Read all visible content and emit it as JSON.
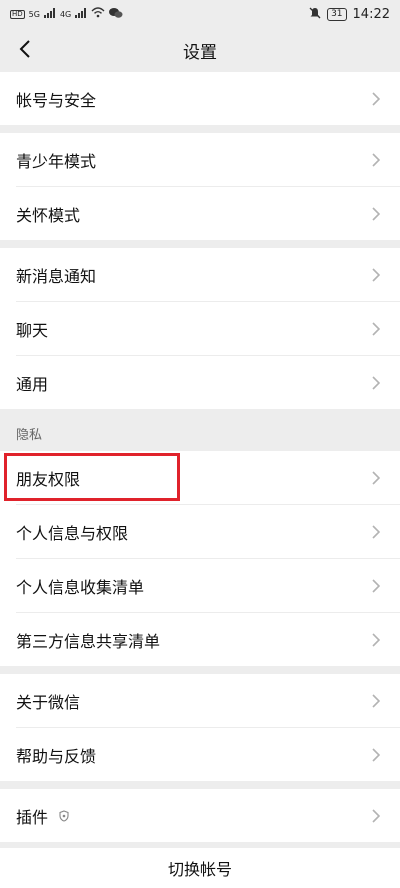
{
  "status_bar": {
    "hd1": "HD",
    "hd2": "HD",
    "net1": "5G",
    "net2": "4G",
    "battery": "31",
    "time": "14:22",
    "wechat_icon": "wechat-icon",
    "wifi_icon": "wifi-icon",
    "mute_icon": "mute-icon"
  },
  "nav": {
    "title": "设置",
    "back_icon": "chevron-left-icon"
  },
  "groups": {
    "account": {
      "items": [
        "帐号与安全"
      ]
    },
    "mode": {
      "items": [
        "青少年模式",
        "关怀模式"
      ]
    },
    "general": {
      "items": [
        "新消息通知",
        "聊天",
        "通用"
      ]
    },
    "privacy": {
      "label": "隐私",
      "items": [
        "朋友权限",
        "个人信息与权限",
        "个人信息收集清单",
        "第三方信息共享清单"
      ]
    },
    "about": {
      "items": [
        "关于微信",
        "帮助与反馈"
      ]
    },
    "plugins": {
      "items": [
        "插件"
      ],
      "shield_icon": "shield-icon"
    }
  },
  "bottom": {
    "switch_account": "切换帐号"
  },
  "colors": {
    "background": "#ededed",
    "highlight": "#e0222b"
  }
}
